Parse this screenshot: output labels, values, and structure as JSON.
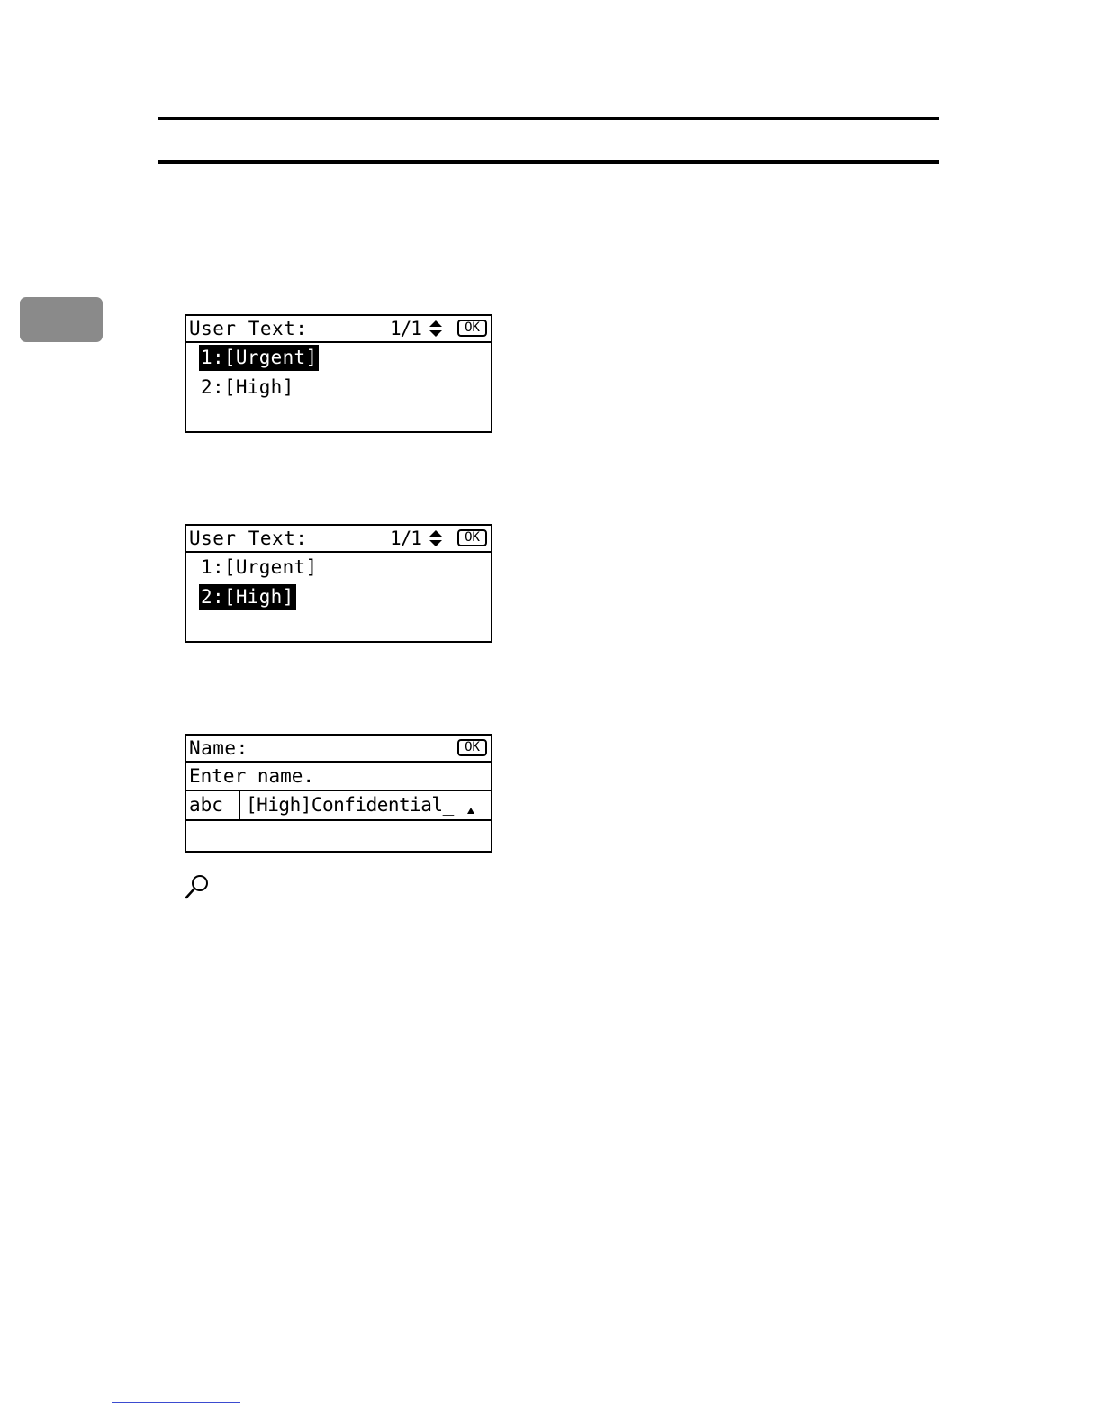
{
  "screens": [
    {
      "title": "User Text:",
      "page": "1/1",
      "ok_label": "OK",
      "items": [
        {
          "label": "1:[Urgent]",
          "selected": true
        },
        {
          "label": "2:[High]",
          "selected": false
        }
      ]
    },
    {
      "title": "User Text:",
      "page": "1/1",
      "ok_label": "OK",
      "items": [
        {
          "label": "1:[Urgent]",
          "selected": false
        },
        {
          "label": "2:[High]",
          "selected": true
        }
      ]
    },
    {
      "title": "Name:",
      "ok_label": "OK",
      "message": "Enter name.",
      "mode": "abc",
      "input_value": "[High]Confidential_"
    }
  ],
  "icons": {
    "scroll": "up-down-arrow-icon",
    "reference": "magnifier-icon"
  },
  "colors": {
    "chapter_tab": "#8a8a8a",
    "footer_link": "#3b4bd0"
  }
}
